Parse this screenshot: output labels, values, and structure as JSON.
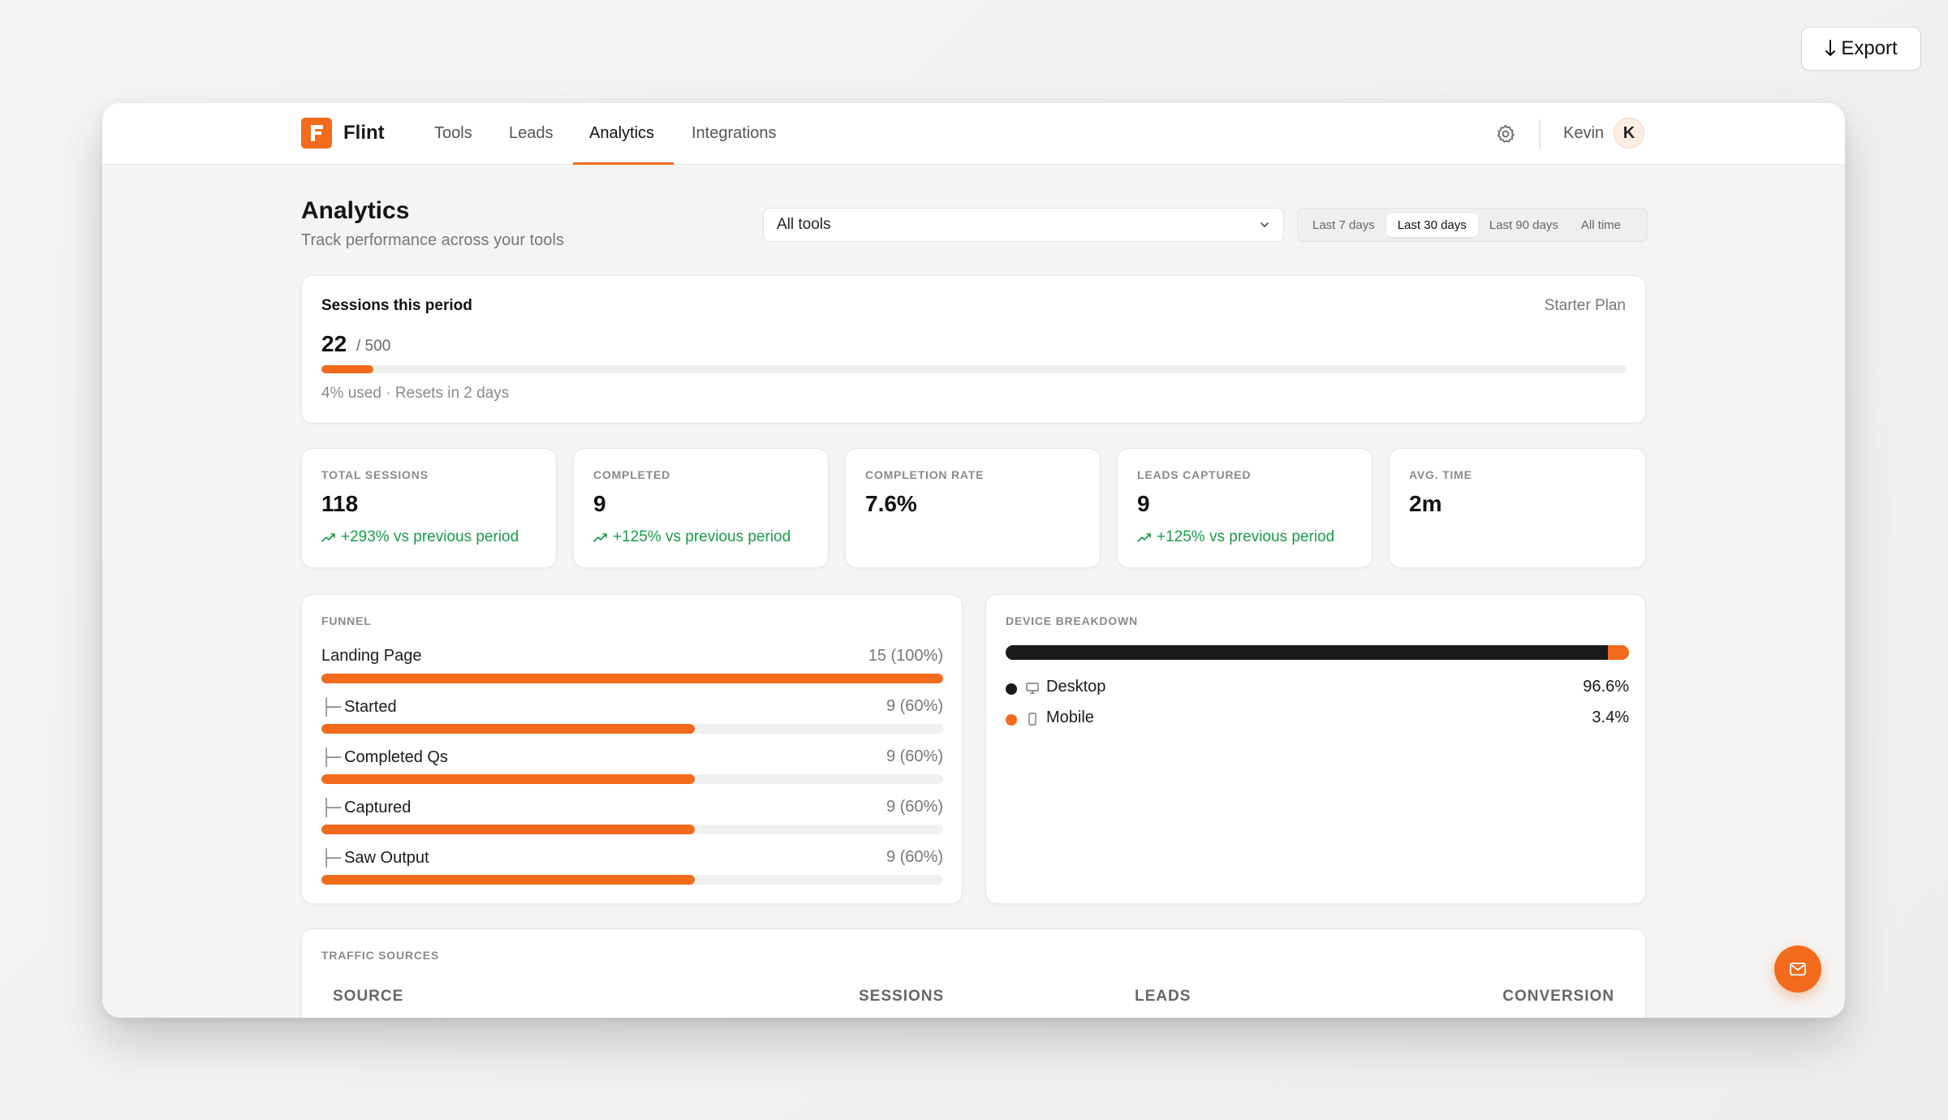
{
  "export_button": {
    "label": "Export",
    "icon": "download-arrow-icon"
  },
  "app": {
    "name": "Flint",
    "brand_color": "#f26b1d"
  },
  "nav": {
    "tabs": [
      {
        "label": "Tools"
      },
      {
        "label": "Leads"
      },
      {
        "label": "Analytics",
        "active": true
      },
      {
        "label": "Integrations"
      }
    ],
    "user_name": "Kevin",
    "avatar_initial": "K"
  },
  "header": {
    "title": "Analytics",
    "subtitle": "Track performance across your tools",
    "tool_filter": "All tools",
    "ranges": [
      "Last 7 days",
      "Last 30 days",
      "Last 90 days",
      "All time"
    ],
    "active_range": "Last 30 days"
  },
  "usage": {
    "title": "Sessions this period",
    "plan": "Starter Plan",
    "count": "22",
    "limit": "/ 500",
    "fill_fraction": 0.04,
    "note": "4% used · Resets in 2 days"
  },
  "stats": [
    {
      "label": "TOTAL SESSIONS",
      "value": "118",
      "delta": "+293% vs previous period"
    },
    {
      "label": "COMPLETED",
      "value": "9",
      "delta": "+125% vs previous period"
    },
    {
      "label": "COMPLETION RATE",
      "value": "7.6%",
      "delta": ""
    },
    {
      "label": "LEADS CAPTURED",
      "value": "9",
      "delta": "+125% vs previous period"
    },
    {
      "label": "AVG. TIME",
      "value": "2m",
      "delta": ""
    }
  ],
  "funnel": {
    "label": "FUNNEL",
    "tree_glyph": "├─",
    "steps": [
      {
        "name": "Landing Page",
        "value": "15 (100%)",
        "fraction": 1.0,
        "indent": false
      },
      {
        "name": "Started",
        "value": "9 (60%)",
        "fraction": 0.6,
        "indent": true
      },
      {
        "name": "Completed Qs",
        "value": "9 (60%)",
        "fraction": 0.6,
        "indent": true
      },
      {
        "name": "Captured",
        "value": "9 (60%)",
        "fraction": 0.6,
        "indent": true
      },
      {
        "name": "Saw Output",
        "value": "9 (60%)",
        "fraction": 0.6,
        "indent": true
      }
    ]
  },
  "devices": {
    "label": "DEVICE BREAKDOWN",
    "items": [
      {
        "name": "Desktop",
        "pct": "96.6%",
        "fraction": 0.966,
        "color": "#1a1a1a",
        "icon": "monitor-icon"
      },
      {
        "name": "Mobile",
        "pct": "3.4%",
        "fraction": 0.034,
        "color": "#f26b1d",
        "icon": "phone-icon"
      }
    ]
  },
  "traffic": {
    "label": "TRAFFIC SOURCES",
    "columns": [
      "SOURCE",
      "SESSIONS",
      "LEADS",
      "CONVERSION"
    ]
  },
  "fab": {
    "icon": "mail-icon"
  }
}
